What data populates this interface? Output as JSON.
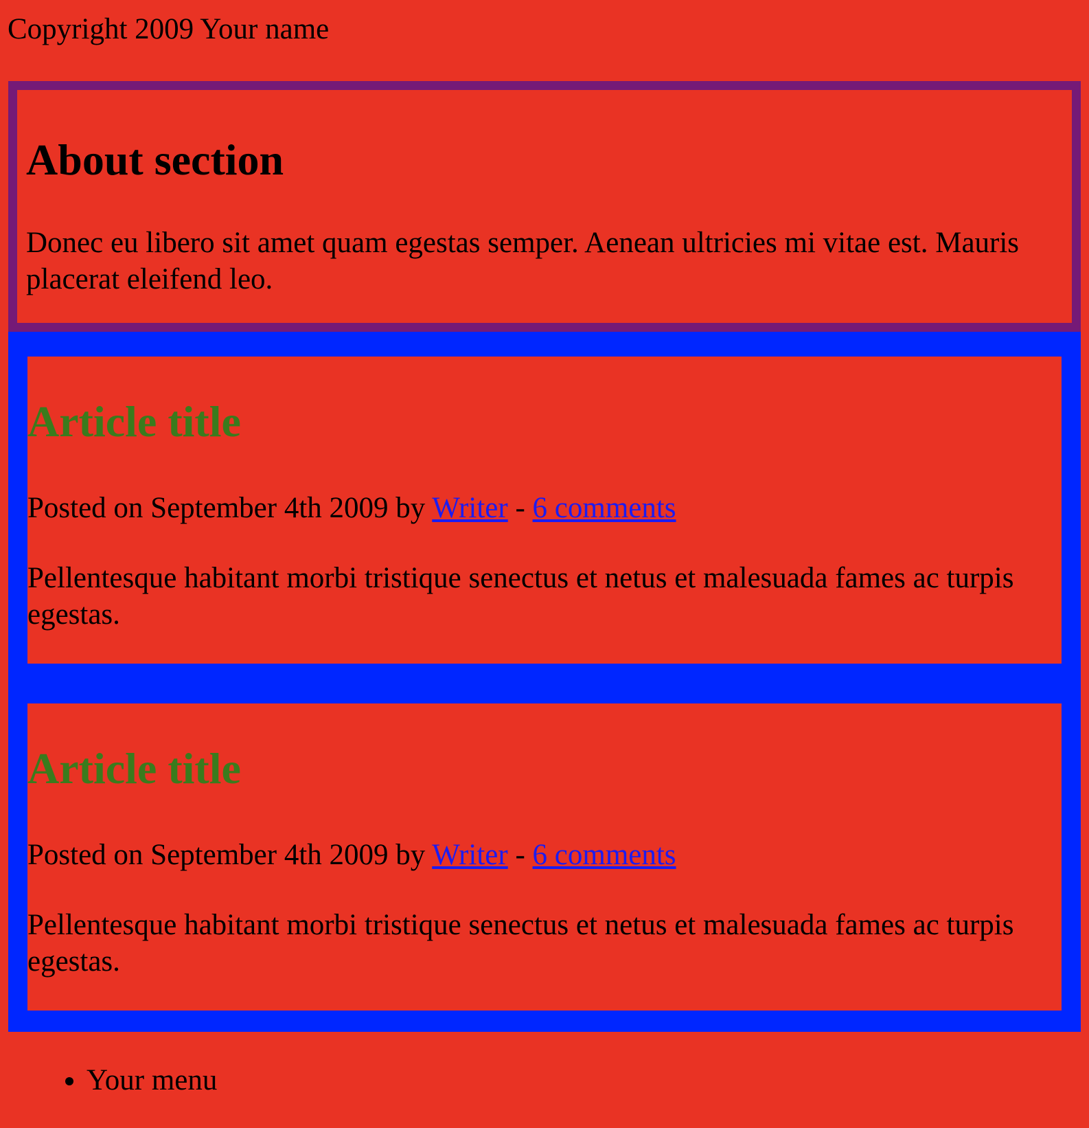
{
  "footer": {
    "copyright": "Copyright 2009 Your name"
  },
  "about": {
    "heading": "About section",
    "text": "Donec eu libero sit amet quam egestas semper. Aenean ultricies mi vitae est. Mauris placerat eleifend leo."
  },
  "articles": [
    {
      "title": "Article title",
      "posted_prefix": "Posted on September 4th 2009 by ",
      "author_link": "Writer",
      "separator": " - ",
      "comments_link": "6 comments",
      "body": "Pellentesque habitant morbi tristique senectus et netus et malesuada fames ac turpis egestas."
    },
    {
      "title": "Article title",
      "posted_prefix": "Posted on September 4th 2009 by ",
      "author_link": "Writer",
      "separator": " - ",
      "comments_link": "6 comments",
      "body": "Pellentesque habitant morbi tristique senectus et netus et malesuada fames ac turpis egestas."
    }
  ],
  "menu": {
    "items": [
      "Your menu"
    ]
  },
  "colors": {
    "page_background": "#e93324",
    "about_border": "#751a77",
    "articles_background": "#0026ff",
    "article_title": "#3a7b1d",
    "link": "#1c1cf0"
  }
}
